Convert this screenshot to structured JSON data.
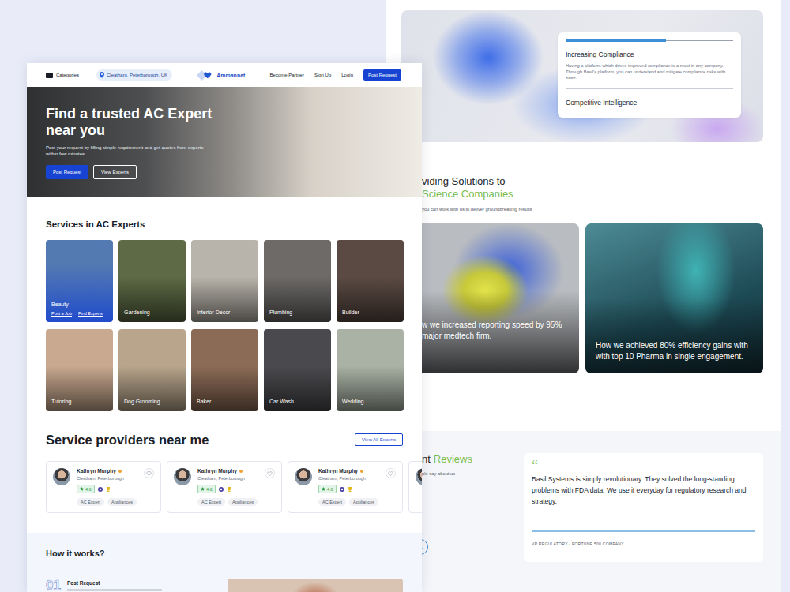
{
  "back_page": {
    "feature": {
      "level": 0.6,
      "title": "Increasing Compliance",
      "body": "Having a platform which drives improved compliance is a must in any company. Through Basil's platform, you can understand and mitigate compliance risks with ease.",
      "next": "Competitive Intelligence"
    },
    "solutions": {
      "title": "viding Solutions to",
      "title_accent": "Science Companies",
      "subtitle": "you can work with us to deliver groundbreaking results",
      "cases": [
        {
          "lines": [
            "w we increased reporting speed by 95%",
            "major medtech firm."
          ]
        },
        {
          "lines": [
            "How we achieved 80% efficiency gains with",
            "with top 10 Pharma in single engagement."
          ]
        }
      ]
    },
    "reviews": {
      "title": "nt",
      "title_accent": "Reviews",
      "subtitle": "ple say about us",
      "arrow": "→",
      "quote_mark": "“",
      "quote": "Basil Systems is simply revolutionary. They solved the long-standing problems with FDA data. We use it everyday for regulatory research and strategy.",
      "author": "VP REGULATORY - FORTUNE 500 COMPANY"
    }
  },
  "front_page": {
    "nav": {
      "categories": "Categories",
      "location": "Cleatham, Peterborough, UK",
      "logo": "Ammannat",
      "links": [
        "Become Partner",
        "Sign Up",
        "Login"
      ],
      "cta": "Post Request"
    },
    "hero": {
      "title": "Find a trusted AC Expert near you",
      "subtitle": "Post your request by filling simple requirement and get quotes from experts within few minutes.",
      "buttons": [
        "Post Request",
        "View Experts"
      ]
    },
    "services": {
      "title": "Services in AC Experts",
      "items": [
        {
          "label": "Beauty",
          "selected": true,
          "links": [
            "Post a Job",
            "Find Experts"
          ]
        },
        {
          "label": "Gardening",
          "selected": false,
          "links": []
        },
        {
          "label": "Interior Decor",
          "selected": false,
          "links": []
        },
        {
          "label": "Plumbing",
          "selected": false,
          "links": []
        },
        {
          "label": "Builder",
          "selected": false,
          "links": []
        },
        {
          "label": "Tutoring",
          "selected": false,
          "links": []
        },
        {
          "label": "Dog Grooming",
          "selected": false,
          "links": []
        },
        {
          "label": "Baker",
          "selected": false,
          "links": []
        },
        {
          "label": "Car Wash",
          "selected": false,
          "links": []
        },
        {
          "label": "Wedding",
          "selected": false,
          "links": []
        }
      ]
    },
    "providers": {
      "title": "Service providers near me",
      "view_all": "View All Experts",
      "cards": [
        {
          "name": "Kathryn Murphy",
          "verified": true,
          "location": "Cleatham, Peterborough",
          "rating": "4.6",
          "favorite": false,
          "tags": [
            "AC Expert",
            "Appliances"
          ]
        },
        {
          "name": "Kathryn Murphy",
          "verified": true,
          "location": "Cleatham, Peterborough",
          "rating": "4.6",
          "favorite": false,
          "tags": [
            "AC Expert",
            "Appliances"
          ]
        },
        {
          "name": "Kathryn Murphy",
          "verified": true,
          "location": "Cleatham, Peterborough",
          "rating": "4.6",
          "favorite": false,
          "tags": [
            "AC Expert",
            "Appliances"
          ]
        }
      ]
    },
    "how_it_works": {
      "title": "How it works?",
      "steps": [
        {
          "number": "01",
          "title": "Post Request"
        }
      ]
    }
  }
}
